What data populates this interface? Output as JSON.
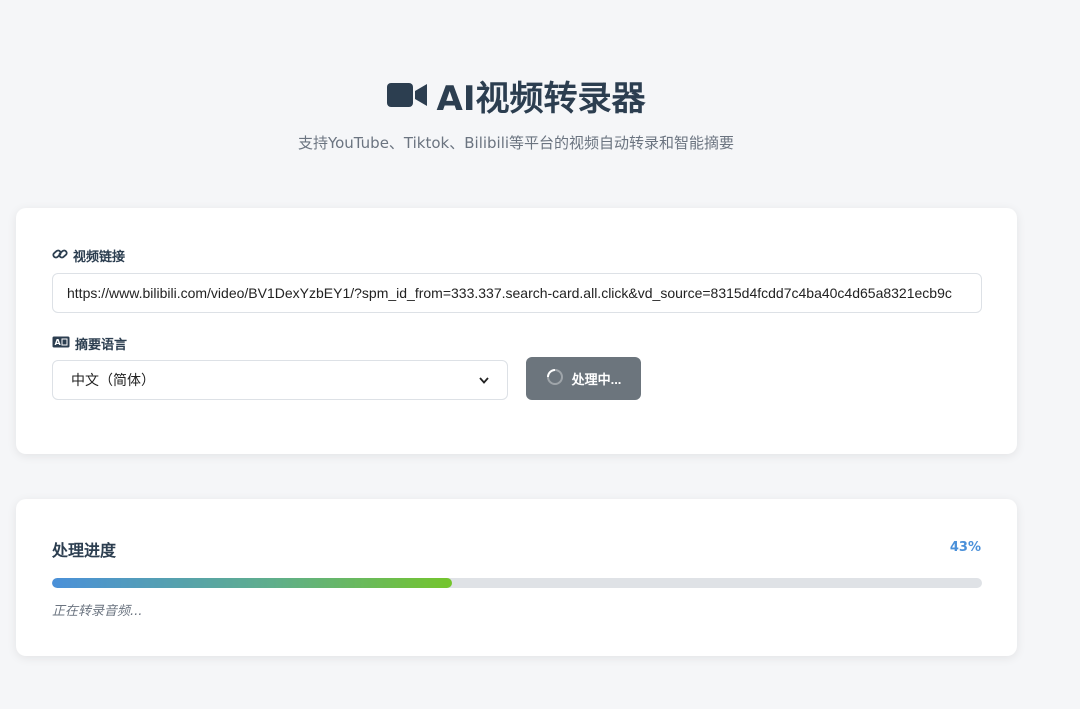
{
  "header": {
    "title": "AI视频转录器",
    "title_icon": "video-camera-icon",
    "subtitle": "支持YouTube、Tiktok、Bilibili等平台的视频自动转录和智能摘要"
  },
  "form": {
    "url_label": "视频链接",
    "url_label_icon": "link-icon",
    "url_value": "https://www.bilibili.com/video/BV1DexYzbEY1/?spm_id_from=333.337.search-card.all.click&vd_source=8315d4fcdd7c4ba40c4d65a8321ecb9c",
    "lang_label": "摘要语言",
    "lang_label_icon": "language-icon",
    "lang_selected": "中文（简体）",
    "submit_label": "处理中...",
    "submit_icon": "spinner-icon"
  },
  "progress": {
    "title": "处理进度",
    "percent_label": "43%",
    "percent_value": 0.43,
    "status": "正在转录音频..."
  },
  "colors": {
    "background": "#f5f6f8",
    "text": "#2c3e50",
    "button_disabled": "#6c757d",
    "accent": "#4a90d9",
    "progress_end": "#74c52c"
  }
}
